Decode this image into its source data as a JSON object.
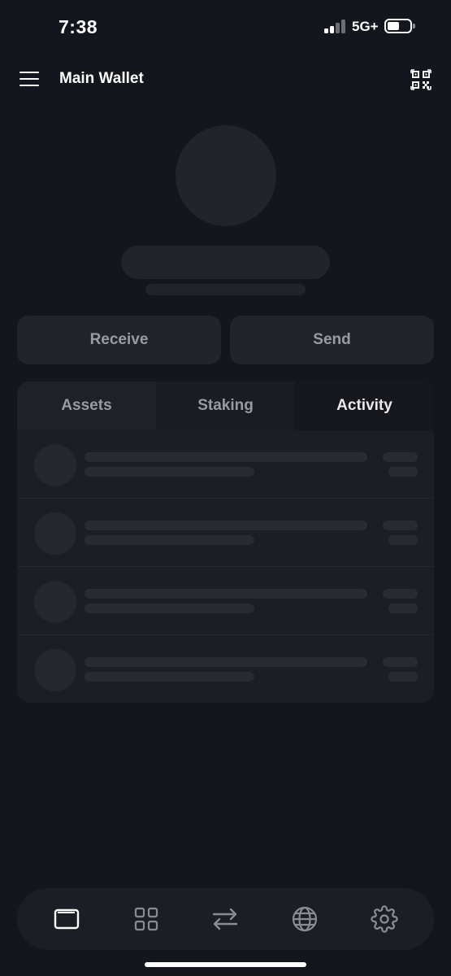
{
  "status_bar": {
    "time": "7:38",
    "network": "5G+",
    "icons": [
      "signal-icon",
      "battery-icon"
    ]
  },
  "header": {
    "title": "Main Wallet",
    "icons": [
      "menu-icon",
      "qr-code-icon"
    ]
  },
  "actions": {
    "receive_label": "Receive",
    "send_label": "Send"
  },
  "tabs": [
    {
      "label": "Assets"
    },
    {
      "label": "Staking"
    },
    {
      "label": "Activity",
      "active": true
    }
  ],
  "list": {
    "state": "loading",
    "skeleton_rows": 4
  },
  "bottom_nav": {
    "items": [
      {
        "icon": "wallet-icon",
        "active": true
      },
      {
        "icon": "apps-grid-icon"
      },
      {
        "icon": "swap-icon"
      },
      {
        "icon": "globe-icon"
      },
      {
        "icon": "settings-gear-icon"
      }
    ]
  },
  "colors": {
    "background": "#14161d",
    "surface": "#1c1e25",
    "skeleton": "#22242b",
    "text_primary": "#ffffff",
    "text_muted": "#9a9ba1",
    "nav_icon": "#8a8c93"
  }
}
